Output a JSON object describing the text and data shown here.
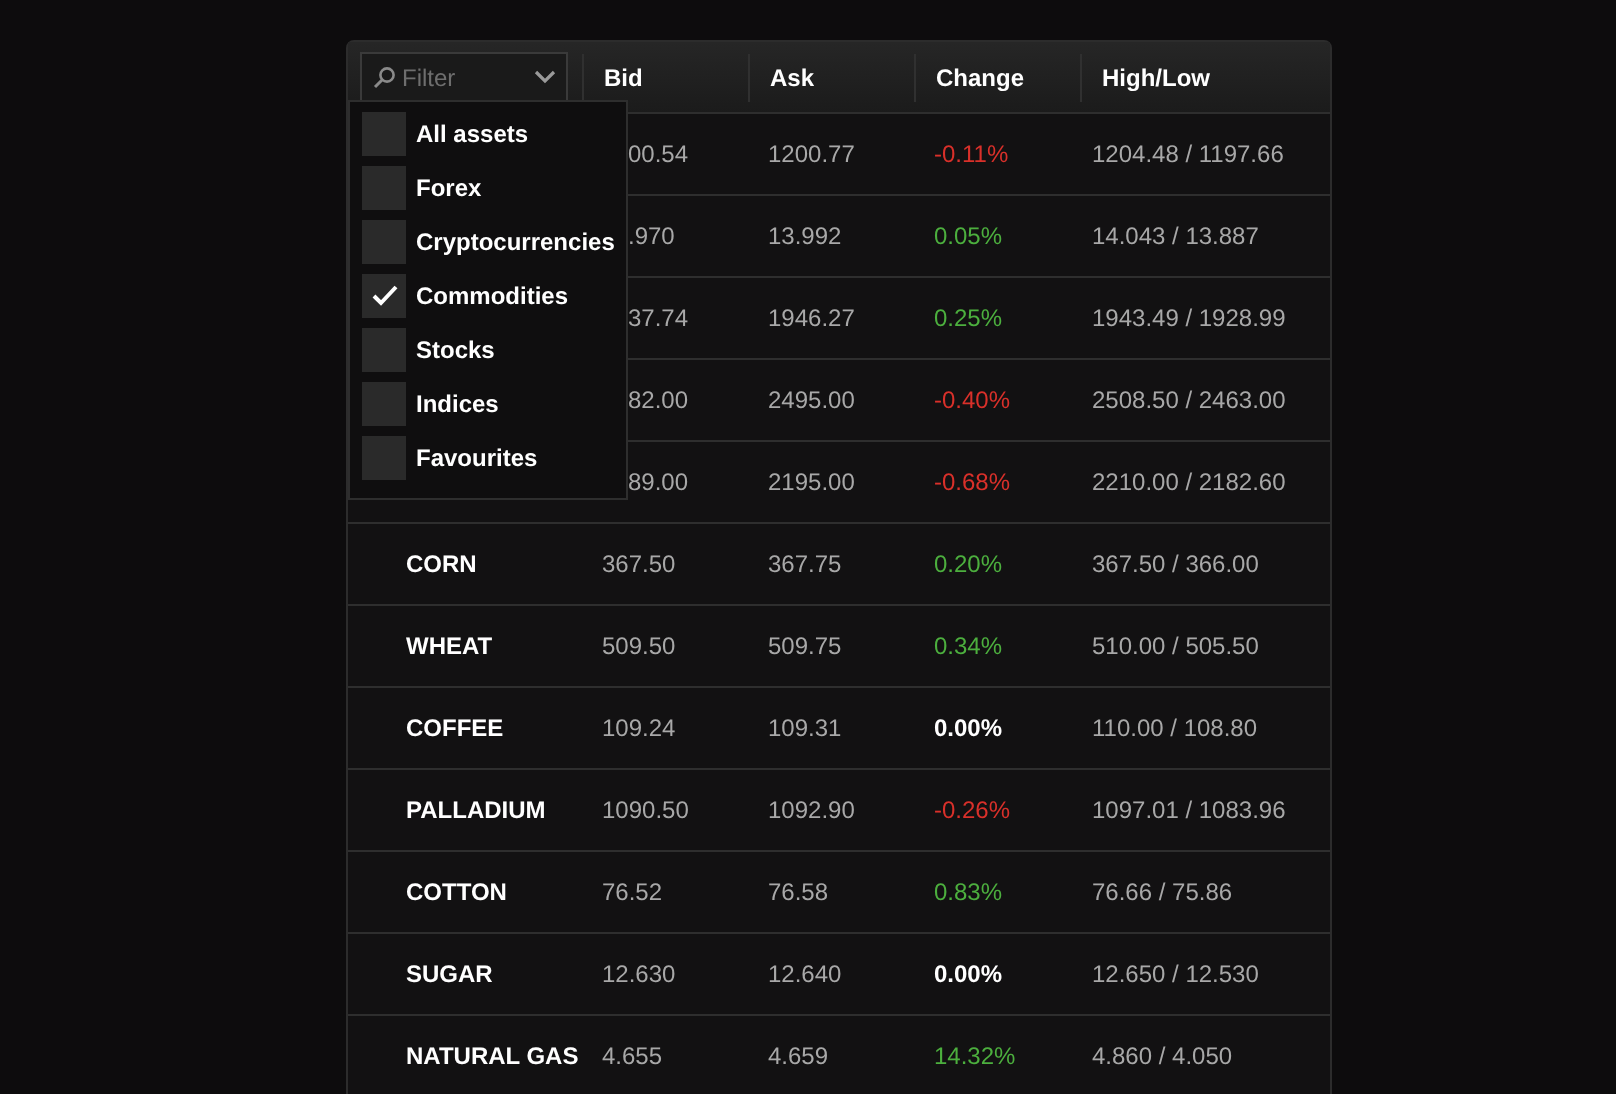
{
  "filter": {
    "placeholder": "Filter",
    "options": [
      {
        "label": "All assets",
        "checked": false
      },
      {
        "label": "Forex",
        "checked": false
      },
      {
        "label": "Cryptocurrencies",
        "checked": false
      },
      {
        "label": "Commodities",
        "checked": true
      },
      {
        "label": "Stocks",
        "checked": false
      },
      {
        "label": "Indices",
        "checked": false
      },
      {
        "label": "Favourites",
        "checked": false
      }
    ]
  },
  "columns": [
    "Bid",
    "Ask",
    "Change",
    "High/Low"
  ],
  "rows": [
    {
      "bid": "00.54",
      "ask": "1200.77",
      "change": "-0.11%",
      "kind": "down",
      "high_low": "1204.48 / 1197.66"
    },
    {
      "bid": ".970",
      "ask": "13.992",
      "change": "0.05%",
      "kind": "up",
      "high_low": "14.043 / 13.887"
    },
    {
      "bid": "37.74",
      "ask": "1946.27",
      "change": "0.25%",
      "kind": "up",
      "high_low": "1943.49 / 1928.99"
    },
    {
      "bid": "82.00",
      "ask": "2495.00",
      "change": "-0.40%",
      "kind": "down",
      "high_low": "2508.50 / 2463.00"
    },
    {
      "bid": "89.00",
      "ask": "2195.00",
      "change": "-0.68%",
      "kind": "down",
      "high_low": "2210.00 / 2182.60"
    },
    {
      "name": "CORN",
      "bid": "367.50",
      "ask": "367.75",
      "change": "0.20%",
      "kind": "up",
      "high_low": "367.50 / 366.00"
    },
    {
      "name": "WHEAT",
      "bid": "509.50",
      "ask": "509.75",
      "change": "0.34%",
      "kind": "up",
      "high_low": "510.00 / 505.50"
    },
    {
      "name": "COFFEE",
      "bid": "109.24",
      "ask": "109.31",
      "change": "0.00%",
      "kind": "flat",
      "high_low": "110.00 / 108.80"
    },
    {
      "name": "PALLADIUM",
      "bid": "1090.50",
      "ask": "1092.90",
      "change": "-0.26%",
      "kind": "down",
      "high_low": "1097.01 / 1083.96"
    },
    {
      "name": "COTTON",
      "bid": "76.52",
      "ask": "76.58",
      "change": "0.83%",
      "kind": "up",
      "high_low": "76.66 / 75.86"
    },
    {
      "name": "SUGAR",
      "bid": "12.630",
      "ask": "12.640",
      "change": "0.00%",
      "kind": "flat",
      "high_low": "12.650 / 12.530"
    },
    {
      "name": "NATURAL GAS",
      "bid": "4.655",
      "ask": "4.659",
      "change": "14.32%",
      "kind": "up",
      "high_low": "4.860 / 4.050"
    }
  ]
}
